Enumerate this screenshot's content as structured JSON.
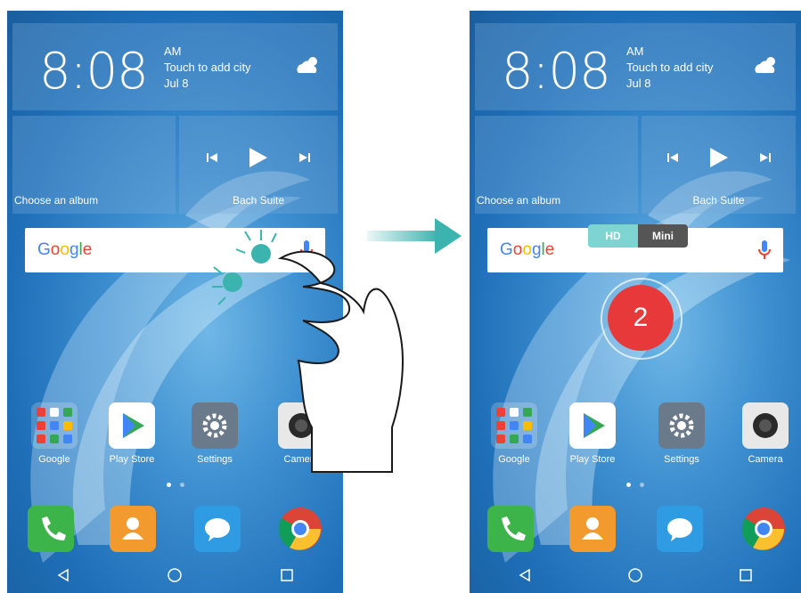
{
  "clock": {
    "time": "8:08",
    "ampm": "AM",
    "city_prompt": "Touch to add city",
    "date": "Jul 8"
  },
  "widgets": {
    "gallery_label": "Choose an album",
    "music_label": "Bach Suite"
  },
  "search": {
    "logo": "Google"
  },
  "apps": [
    {
      "label": "Google",
      "icon": "google-folder-icon"
    },
    {
      "label": "Play Store",
      "icon": "play-store-icon"
    },
    {
      "label": "Settings",
      "icon": "settings-gear-icon"
    },
    {
      "label": "Camera",
      "icon": "camera-icon"
    }
  ],
  "dock": [
    {
      "icon": "phone-icon",
      "color": "#3cb44a"
    },
    {
      "icon": "contacts-icon",
      "color": "#f29a2e"
    },
    {
      "icon": "messages-icon",
      "color": "#2f9be3"
    },
    {
      "icon": "chrome-icon",
      "color": "#ffffff"
    }
  ],
  "screen_record": {
    "hd_label": "HD",
    "mini_label": "Mini",
    "countdown": "2"
  },
  "colors": {
    "accent_teal": "#3bb3ae",
    "countdown_red": "#e8393a"
  }
}
